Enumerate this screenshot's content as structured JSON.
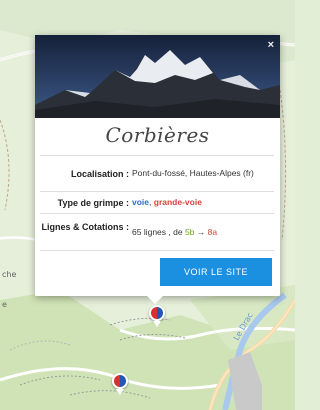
{
  "map": {
    "labels": [
      "che",
      "e"
    ],
    "river_label": "Le Drac",
    "markers": [
      {
        "name": "marker-1",
        "colors": [
          "#d9302c",
          "#2456b8"
        ]
      },
      {
        "name": "marker-2",
        "colors": [
          "#d9302c",
          "#2456b8"
        ]
      }
    ]
  },
  "popup": {
    "close": "×",
    "site_name": "Corbières",
    "rows": {
      "localisation": {
        "label": "Localisation :",
        "value": "Pont-du-fossé, Hautes-Alpes (fr)"
      },
      "type": {
        "label": "Type de grimpe :",
        "voie": "voie",
        "sep": ", ",
        "grande_voie": "grande-voie"
      },
      "lignes": {
        "label": "Lignes & Cotations :",
        "prefix": "65 lignes , de ",
        "min": "5b",
        "arrow": " → ",
        "max": "8a"
      }
    },
    "button": "VOIR LE SITE"
  },
  "colors": {
    "button": "#1c90e0",
    "voie": "#2a6fc7",
    "grande_voie": "#d8443c",
    "grade_min": "#6aa629",
    "grade_max": "#d8443c"
  }
}
